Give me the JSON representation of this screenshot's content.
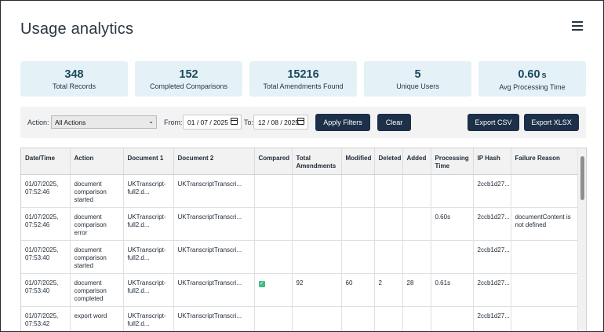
{
  "page": {
    "title": "Usage analytics"
  },
  "menu": {
    "icon": "hamburger-menu-icon"
  },
  "stats": [
    {
      "value": "348",
      "unit": "",
      "label": "Total Records"
    },
    {
      "value": "152",
      "unit": "",
      "label": "Completed Comparisons"
    },
    {
      "value": "15216",
      "unit": "",
      "label": "Total Amendments Found"
    },
    {
      "value": "5",
      "unit": "",
      "label": "Unique Users"
    },
    {
      "value": "0.60",
      "unit": "s",
      "label": "Avg Processing Time"
    }
  ],
  "filters": {
    "action_label": "Action:",
    "action_value": "All Actions",
    "from_label": "From:",
    "from_value": "01 / 07 / 2025",
    "to_label": "To:",
    "to_value": "12 / 08 / 2025",
    "apply_label": "Apply Filters",
    "clear_label": "Clear",
    "export_csv_label": "Export CSV",
    "export_xlsx_label": "Export XLSX"
  },
  "table": {
    "columns": [
      "Date/Time",
      "Action",
      "Document 1",
      "Document 2",
      "Compared",
      "Total Amendments",
      "Modified",
      "Deleted",
      "Added",
      "Processing Time",
      "IP Hash",
      "Failure Reason"
    ],
    "rows": [
      {
        "datetime": "01/07/2025, 07:52:46",
        "action": "document comparison started",
        "doc1": "UKTranscript-full2.d...",
        "doc2": "UKTranscriptTranscri...",
        "compared": false,
        "total": "",
        "modified": "",
        "deleted": "",
        "added": "",
        "time": "",
        "ip": "2ccb1d27...",
        "failure": ""
      },
      {
        "datetime": "01/07/2025, 07:52:46",
        "action": "document comparison error",
        "doc1": "UKTranscript-full2.d...",
        "doc2": "UKTranscriptTranscri...",
        "compared": false,
        "total": "",
        "modified": "",
        "deleted": "",
        "added": "",
        "time": "0.60s",
        "ip": "2ccb1d27...",
        "failure": "documentContent is not defined"
      },
      {
        "datetime": "01/07/2025, 07:53:40",
        "action": "document comparison started",
        "doc1": "UKTranscript-full2.d...",
        "doc2": "UKTranscriptTranscri...",
        "compared": false,
        "total": "",
        "modified": "",
        "deleted": "",
        "added": "",
        "time": "",
        "ip": "2ccb1d27...",
        "failure": ""
      },
      {
        "datetime": "01/07/2025, 07:53:40",
        "action": "document comparison completed",
        "doc1": "UKTranscript-full2.d...",
        "doc2": "UKTranscriptTranscri...",
        "compared": true,
        "total": "92",
        "modified": "60",
        "deleted": "2",
        "added": "28",
        "time": "0.61s",
        "ip": "2ccb1d27...",
        "failure": ""
      },
      {
        "datetime": "01/07/2025, 07:53:42",
        "action": "export word",
        "doc1": "UKTranscript-full2.d...",
        "doc2": "UKTranscriptTranscri...",
        "compared": false,
        "total": "",
        "modified": "",
        "deleted": "",
        "added": "",
        "time": "",
        "ip": "2ccb1d27...",
        "failure": ""
      }
    ]
  }
}
